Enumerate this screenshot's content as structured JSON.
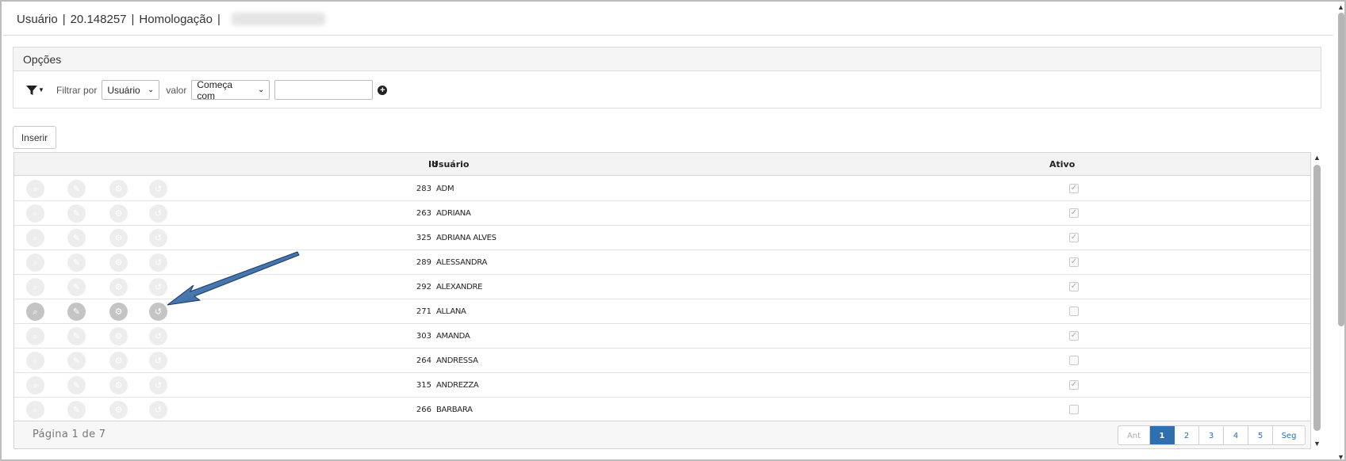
{
  "header": {
    "module": "Usuário",
    "code": "20.148257",
    "environment": "Homologação"
  },
  "options": {
    "title": "Opções",
    "filter_by_label": "Filtrar por",
    "filter_field": "Usuário",
    "value_label": "valor",
    "operator": "Começa com",
    "value_input": ""
  },
  "toolbar": {
    "insert_label": "Inserir"
  },
  "grid": {
    "columns": {
      "id": "Id",
      "user": "Usuário",
      "active": "Ativo"
    },
    "rows": [
      {
        "id": "283",
        "user": "ADM",
        "active": true
      },
      {
        "id": "263",
        "user": "ADRIANA",
        "active": true
      },
      {
        "id": "325",
        "user": "ADRIANA ALVES",
        "active": true
      },
      {
        "id": "289",
        "user": "ALESSANDRA",
        "active": true
      },
      {
        "id": "292",
        "user": "ALEXANDRE",
        "active": true
      },
      {
        "id": "271",
        "user": "ALLANA",
        "active": false
      },
      {
        "id": "303",
        "user": "AMANDA",
        "active": true
      },
      {
        "id": "264",
        "user": "ANDRESSA",
        "active": false
      },
      {
        "id": "315",
        "user": "ANDREZZA",
        "active": true
      },
      {
        "id": "266",
        "user": "BARBARA",
        "active": false
      }
    ],
    "highlighted_row": 5,
    "row_icons": [
      "search-icon",
      "edit-icon",
      "gear-icon",
      "history-icon"
    ]
  },
  "footer": {
    "page_info": "Página 1 de 7",
    "pager": [
      "Ant",
      "1",
      "2",
      "3",
      "4",
      "5",
      "Seg"
    ],
    "current_page": "1"
  },
  "colors": {
    "pager_active": "#2f6fb0",
    "arrow": "#1f4f8a"
  }
}
